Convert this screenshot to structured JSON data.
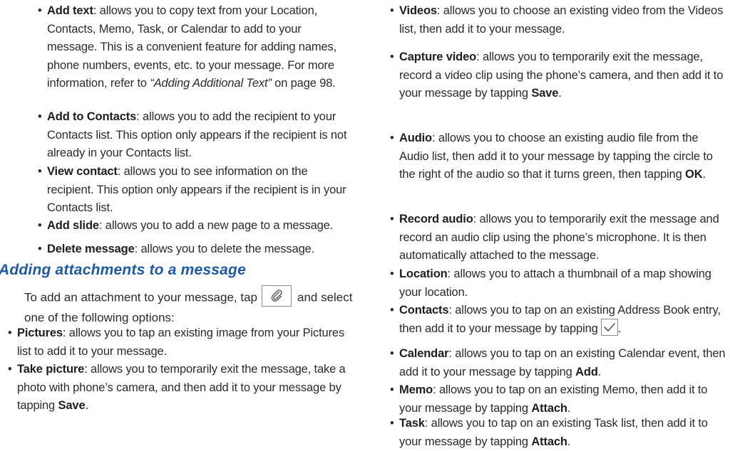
{
  "left_column": {
    "top_items": [
      {
        "label": "Add text",
        "text": ": allows you to copy text from your Location, Contacts, Memo, Task, or Calendar to add to your message. This is a convenient feature for adding names, phone numbers, events, etc. to your message. For more information, refer to ",
        "xref": "“Adding Additional Text”",
        "after": " on page 98."
      },
      {
        "label": "Add to Contacts",
        "text": ": allows you to add the recipient to your Contacts list. This option only appears if the recipient is not already in your Contacts list."
      },
      {
        "label": "View contact",
        "text": ": allows you to see information on the recipient. This option only appears if the recipient is in your Contacts list."
      },
      {
        "label": "Add slide",
        "text": ": allows you to add a new page to a message."
      },
      {
        "label": "Delete message",
        "text": ": allows you to delete the message."
      }
    ],
    "section_heading": "Adding attachments to a message",
    "intro_before": "To add an attachment to your message, tap",
    "intro_after": "and select one of the following options:",
    "attach_icon": "paperclip-icon",
    "options": [
      {
        "label": "Pictures",
        "text": ": allows you to tap an existing image from your Pictures list to add it to your message."
      },
      {
        "label": "Take picture",
        "text": ": allows you to temporarily exit the message, take a photo with phone’s camera, and then add it to your message by tapping ",
        "bold_after": "Save",
        "tail": "."
      }
    ]
  },
  "right_column": {
    "options": [
      {
        "label": "Videos",
        "text": ": allows you to choose an existing video from the Videos list, then add it to your message."
      },
      {
        "label": "Capture video",
        "text": ": allows you to temporarily exit the message, record a video clip using the phone’s camera, and then add it to your message by tapping ",
        "bold_after": "Save",
        "tail": "."
      },
      {
        "label": "Audio",
        "text": ": allows you to choose an existing audio file from the Audio list, then add it to your message by tapping the circle to the right of the audio so that it turns green, then tapping ",
        "bold_after": "OK",
        "tail": "."
      },
      {
        "label": "Record audio",
        "text": ": allows you to temporarily exit the message and record an audio clip using the phone’s microphone. It is then automatically attached to the message."
      },
      {
        "label": "Location",
        "text": ": allows you to attach a thumbnail of a map showing your location."
      },
      {
        "label": "Contacts",
        "text": ": allows you to tap on an existing Address Book entry, then add it to your message by tapping",
        "icon": "checkmark-icon",
        "tail": "."
      },
      {
        "label": "Calendar",
        "text": ": allows you to tap on an existing Calendar event, then add it to your message by tapping ",
        "bold_after": "Add",
        "tail": "."
      },
      {
        "label": "Memo",
        "text": ": allows you to tap on an existing Memo, then add it to your message by tapping ",
        "bold_after": "Attach",
        "tail": "."
      },
      {
        "label": "Task",
        "text": ": allows you to tap on an existing Task list, then add it to your message by tapping ",
        "bold_after": "Attach",
        "tail": "."
      }
    ]
  },
  "colors": {
    "heading": "#1d59a8",
    "text": "#2b2b2b"
  }
}
